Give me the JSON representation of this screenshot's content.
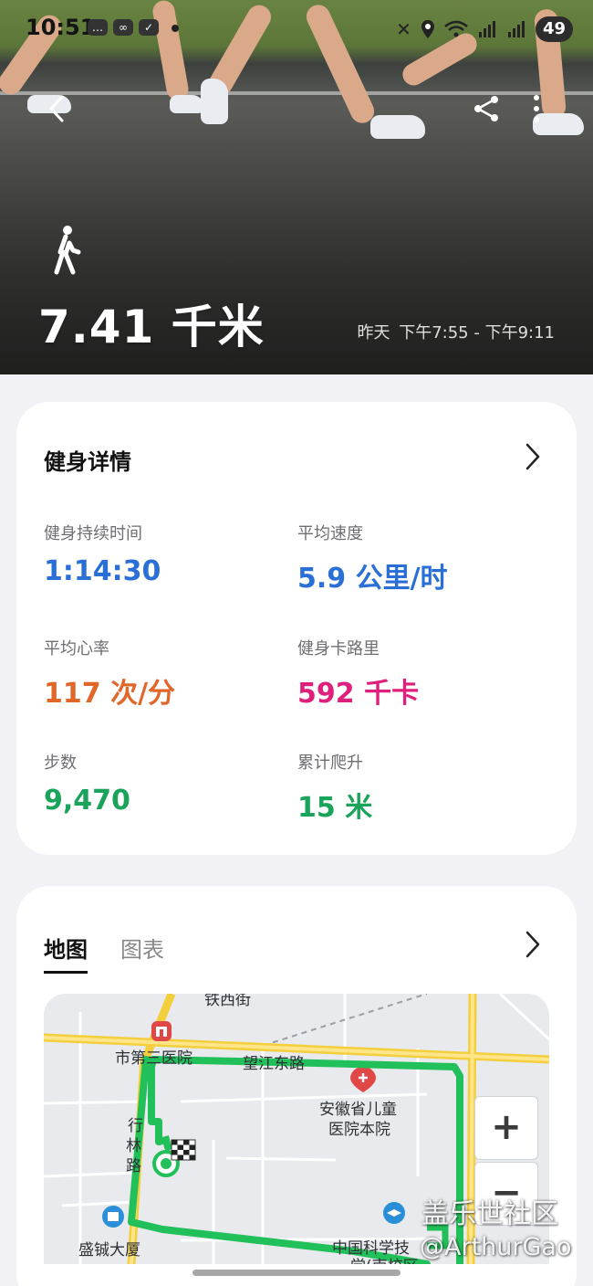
{
  "status_bar": {
    "time": "10:51",
    "battery": "49",
    "left_icons": [
      "chat-icon",
      "voicemail-icon",
      "app-icon"
    ],
    "right_icons": [
      "mute-icon",
      "location-icon",
      "wifi-icon",
      "signal-5g-icon",
      "signal-5g-icon"
    ]
  },
  "header": {
    "activity_icon": "walking-icon",
    "distance": "7.41 千米",
    "day": "昨天",
    "time_range": "下午7:55 - 下午9:11"
  },
  "details": {
    "title": "健身详情",
    "metrics": [
      {
        "label": "健身持续时间",
        "value": "1:14:30",
        "color": "#2a6fd6"
      },
      {
        "label": "平均速度",
        "value": "5.9 公里/时",
        "color": "#2a6fd6"
      },
      {
        "label": "平均心率",
        "value": "117 次/分",
        "color": "#e0662a"
      },
      {
        "label": "健身卡路里",
        "value": "592 千卡",
        "color": "#de1f7c"
      },
      {
        "label": "步数",
        "value": "9,470",
        "color": "#1aa35a"
      },
      {
        "label": "累计爬升",
        "value": "15 米",
        "color": "#1aa35a"
      }
    ]
  },
  "map_section": {
    "tabs": [
      "地图",
      "图表"
    ],
    "active_tab": "地图",
    "labels": {
      "top_road": "铁西街",
      "hospital_top": "市第三医院",
      "road_top": "望江东路",
      "childrens_hospital_1": "安徽省儿童",
      "childrens_hospital_2": "医院本院",
      "side_road_left_1": "行",
      "side_road_left_2": "林",
      "side_road_left_3": "路",
      "building": "盛铖大厦",
      "university": "中国科学技",
      "university_2": "学(南校区"
    },
    "zoom_in": "+",
    "zoom_out": "−",
    "route_color": "#22c05a"
  },
  "watermark": {
    "line1": "盖乐世社区",
    "line2": "@ArthurGao"
  }
}
